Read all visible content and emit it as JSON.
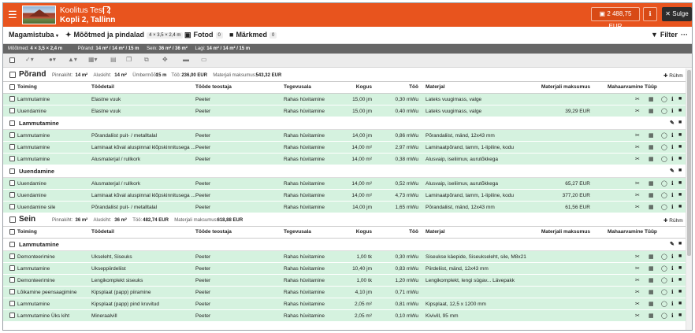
{
  "header": {
    "title": "Koolitus Test 2",
    "address": "Kopli 2, Tallinn",
    "total": "2 488,75 EUR",
    "close_label": "Sulge",
    "brand_color": "#e8541e"
  },
  "toolbar": {
    "room": "Magamistuba",
    "dims_label": "Mõõtmed ja pindalad",
    "dims_chip": "4 × 3,5 × 2,4 m",
    "photos_label": "Fotod",
    "photos_count": "0",
    "notes_label": "Märkmed",
    "notes_count": "0",
    "filter_label": "Filter"
  },
  "dimbar": {
    "text1": "Mõõtmed:",
    "v1": "4 × 3,5 × 2,4 m",
    "text2": "Põrand:",
    "v2": "14 m² / 14 m² / 15 m",
    "text3": "Sein:",
    "v3": "36 m² / 36 m²",
    "text4": "Lagi:",
    "v4": "14 m² / 14 m² / 15 m"
  },
  "columns": {
    "toiming": "Toiming",
    "tootedetail": "Töödetail",
    "teostaja": "Tööde teostaja",
    "tegevusala": "Tegevusala",
    "kogus": "Kogus",
    "too": "Töö",
    "materjal": "Materjal",
    "materjali_maksumus": "Materjali maksumus",
    "mahaarvamine": "Mahaarvamine",
    "tuup": "Tüüp"
  },
  "add_group_label": "Rühm",
  "sections": [
    {
      "title": "Põrand",
      "stats": [
        {
          "l": "Pinnakiht:",
          "v": "14 m²"
        },
        {
          "l": "Aluskiht:",
          "v": "14 m²"
        },
        {
          "l": "Ümbermõõt:",
          "v": "15 m"
        },
        {
          "l": "Töö:",
          "v": "236,00 EUR"
        },
        {
          "l": "Materjali maksumus:",
          "v": "543,32 EUR"
        }
      ],
      "items": [
        {
          "type": "row",
          "toiming": "Lammutamine",
          "tootedetail": "Elastne vuuk",
          "teostaja": "Peeter",
          "tegevusala": "Rahas hüvitamine",
          "kogus": "15,00 jm",
          "too": "0,30 mWu",
          "materjal": "Lateks vuugimass, valge",
          "maksumus": ""
        },
        {
          "type": "row",
          "toiming": "Uuendamine",
          "tootedetail": "Elastne vuuk",
          "teostaja": "Peeter",
          "tegevusala": "Rahas hüvitamine",
          "kogus": "15,00 jm",
          "too": "0,40 mWu",
          "materjal": "Lateks vuugimass, valge",
          "maksumus": "39,29 EUR"
        },
        {
          "type": "group",
          "title": "Lammutamine"
        },
        {
          "type": "row",
          "toiming": "Lammutamine",
          "tootedetail": "Põrandaliist puit- / metalltalal",
          "teostaja": "Peeter",
          "tegevusala": "Rahas hüvitamine",
          "kogus": "14,00 jm",
          "too": "0,86 mWu",
          "materjal": "Põrandaliist, mänd, 12x43 mm",
          "maksumus": ""
        },
        {
          "type": "row",
          "toiming": "Lammutamine",
          "tootedetail": "Laminaat kõval aluspinnal klõpskinnitusega ...",
          "teostaja": "Peeter",
          "tegevusala": "Rahas hüvitamine",
          "kogus": "14,00 m²",
          "too": "2,97 mWu",
          "materjal": "Laminaatpõrand, tamm, 1-lipiline, kodu",
          "maksumus": ""
        },
        {
          "type": "row",
          "toiming": "Lammutamine",
          "tootedetail": "Alusmaterjal / rullkork",
          "teostaja": "Peeter",
          "tegevusala": "Rahas hüvitamine",
          "kogus": "14,00 m²",
          "too": "0,38 mWu",
          "materjal": "Alusvaip, iseliimuv, aurutõkkega",
          "maksumus": ""
        },
        {
          "type": "group",
          "title": "Uuendamine"
        },
        {
          "type": "row",
          "toiming": "Uuendamine",
          "tootedetail": "Alusmaterjal / rullkork",
          "teostaja": "Peeter",
          "tegevusala": "Rahas hüvitamine",
          "kogus": "14,00 m²",
          "too": "0,52 mWu",
          "materjal": "Alusvaip, iseliimuv, aurutõkkega",
          "maksumus": "65,27 EUR"
        },
        {
          "type": "row",
          "toiming": "Uuendamine",
          "tootedetail": "Laminaat kõval aluspinnal klõpskinnitusega ...",
          "teostaja": "Peeter",
          "tegevusala": "Rahas hüvitamine",
          "kogus": "14,00 m²",
          "too": "4,73 mWu",
          "materjal": "Laminaatpõrand, tamm, 1-lipiline, kodu",
          "maksumus": "377,20 EUR"
        },
        {
          "type": "row",
          "toiming": "Uuendamine sile",
          "tootedetail": "Põrandaliist puit- / metalltalal",
          "teostaja": "Peeter",
          "tegevusala": "Rahas hüvitamine",
          "kogus": "14,00 jm",
          "too": "1,65 mWu",
          "materjal": "Põrandaliist, mänd, 12x43 mm",
          "maksumus": "61,56 EUR"
        }
      ]
    },
    {
      "title": "Sein",
      "stats": [
        {
          "l": "Pinnakiht:",
          "v": "36 m²"
        },
        {
          "l": "Aluskiht:",
          "v": "36 m²"
        },
        {
          "l": "Töö:",
          "v": "482,74 EUR"
        },
        {
          "l": "Materjali maksumus:",
          "v": "618,88 EUR"
        }
      ],
      "items": [
        {
          "type": "group",
          "title": "Lammutamine"
        },
        {
          "type": "row",
          "toiming": "Demonteerimine",
          "tootedetail": "Ukseleht, Siseuks",
          "teostaja": "Peeter",
          "tegevusala": "Rahas hüvitamine",
          "kogus": "1,00 tk",
          "too": "0,30 mWu",
          "materjal": "Siseukse käepide, Siseukseleht, sile, M8x21",
          "maksumus": ""
        },
        {
          "type": "row",
          "toiming": "Lammutamine",
          "tootedetail": "Ukseppiirdeliist",
          "teostaja": "Peeter",
          "tegevusala": "Rahas hüvitamine",
          "kogus": "10,40 jm",
          "too": "0,83 mWu",
          "materjal": "Piirdeliist, mänd, 12x43 mm",
          "maksumus": ""
        },
        {
          "type": "row",
          "toiming": "Demonteerimine",
          "tootedetail": "Lengikomplekt siseuks",
          "teostaja": "Peeter",
          "tegevusala": "Rahas hüvitamine",
          "kogus": "1,00 tk",
          "too": "1,20 mWu",
          "materjal": "Lengikomplekt, lengi sügav...     Lävepakk",
          "maksumus": ""
        },
        {
          "type": "row",
          "toiming": "Lõikamine peensaagimine",
          "tootedetail": "Kipsplaat (papp) piiramine",
          "teostaja": "Peeter",
          "tegevusala": "Rahas hüvitamine",
          "kogus": "4,10 jm",
          "too": "0,71 mWu",
          "materjal": "",
          "maksumus": ""
        },
        {
          "type": "row",
          "toiming": "Lammutamine",
          "tootedetail": "Kipsplaat (papp) pind kruvitud",
          "teostaja": "Peeter",
          "tegevusala": "Rahas hüvitamine",
          "kogus": "2,05 m²",
          "too": "0,81 mWu",
          "materjal": "Kipsplaat, 12,5 x 1200 mm",
          "maksumus": ""
        },
        {
          "type": "row",
          "toiming": "Lammutamine Üks kiht",
          "tootedetail": "Mineraalvill",
          "teostaja": "Peeter",
          "tegevusala": "Rahas hüvitamine",
          "kogus": "2,05 m²",
          "too": "0,10 mWu",
          "materjal": "Kivivill, 95 mm",
          "maksumus": ""
        }
      ]
    }
  ]
}
